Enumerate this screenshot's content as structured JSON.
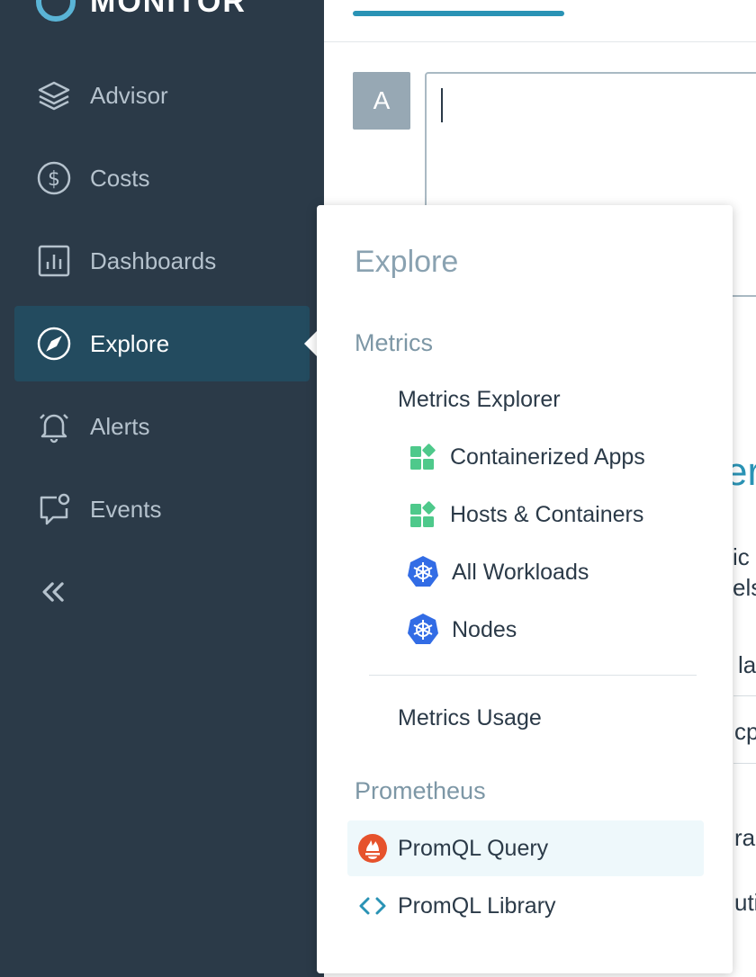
{
  "brand": {
    "name": "MONITOR"
  },
  "sidebar": {
    "items": [
      {
        "label": "Advisor",
        "icon": "advisor-layers-icon"
      },
      {
        "label": "Costs",
        "icon": "dollar-circle-icon"
      },
      {
        "label": "Dashboards",
        "icon": "bar-chart-icon"
      },
      {
        "label": "Explore",
        "icon": "compass-icon",
        "active": true
      },
      {
        "label": "Alerts",
        "icon": "bell-icon"
      },
      {
        "label": "Events",
        "icon": "chat-bubble-icon"
      }
    ],
    "collapse_icon": "double-chevron-left-icon"
  },
  "main": {
    "avatar_letter": "A",
    "background_fragments": [
      "er",
      "ic",
      "els",
      "la",
      "cpu",
      "ra",
      "uti"
    ]
  },
  "explore_menu": {
    "title": "Explore",
    "metrics_section": "Metrics",
    "metrics_explorer": "Metrics Explorer",
    "items": [
      {
        "label": "Containerized Apps",
        "icon": "green-blocks-icon"
      },
      {
        "label": "Hosts & Containers",
        "icon": "green-blocks-icon"
      },
      {
        "label": "All Workloads",
        "icon": "kubernetes-icon"
      },
      {
        "label": "Nodes",
        "icon": "kubernetes-icon"
      }
    ],
    "metrics_usage": "Metrics Usage",
    "prometheus_section": "Prometheus",
    "promql_query": "PromQL Query",
    "promql_library": "PromQL Library"
  },
  "colors": {
    "sidebar_bg": "#2b3a48",
    "active_bg": "#234b5f",
    "accent": "#2a93b5",
    "prometheus": "#e6522c",
    "kubernetes": "#326ce5",
    "green": "#4ec98b"
  }
}
